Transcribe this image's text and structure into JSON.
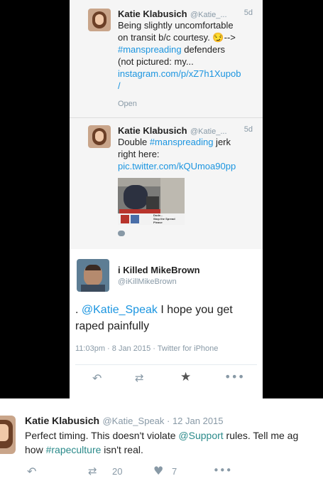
{
  "thread": [
    {
      "name": "Katie Klabusich",
      "handle": "@Katie_...",
      "age": "5d",
      "text_line1": "Being slightly uncomfortable",
      "text_line2": "on transit b/c courtesy. 😏-->",
      "hashtag": "#manspreading",
      "text_line3": " defenders",
      "text_line4": "(not pictured: my...",
      "link": "instagram.com/p/xZ7h1Xupob",
      "link2": "/",
      "open": "Open"
    },
    {
      "name": "Katie Klabusich",
      "handle": "@Katie_...",
      "age": "5d",
      "text_pre": "Double ",
      "hashtag": "#manspreading",
      "text_post": " jerk",
      "text_line2": "right here:",
      "link": "pic.twitter.com/kQUmoa90pp",
      "sign_lines": [
        "Dude...",
        "Stop the Spread",
        "Please"
      ]
    }
  ],
  "main_tweet": {
    "name": "i Killed MikeBrown",
    "handle": "@iKillMikeBrown",
    "text_pre": ". ",
    "mention": "@Katie_Speak",
    "text_post": " I hope you get",
    "text_line2": "raped painfully",
    "meta": "11:03pm · 8 Jan 2015 · Twitter for iPhone"
  },
  "reply": {
    "name": "Katie Klabusich",
    "handle_date": "@Katie_Speak · 12 Jan 2015",
    "line1_pre": "Perfect timing. This doesn't violate ",
    "mention": "@Support",
    "line1_post": " rules. Tell me ag",
    "line2_pre": "how ",
    "hashtag": "#rapeculture",
    "line2_post": " isn't real.",
    "retweets": "20",
    "likes": "7"
  },
  "icons": {
    "reply": "reply-icon",
    "retweet": "retweet-icon",
    "favorite": "star-icon",
    "like": "heart-icon",
    "more": "more-icon",
    "comment": "comment-bubble-icon"
  }
}
